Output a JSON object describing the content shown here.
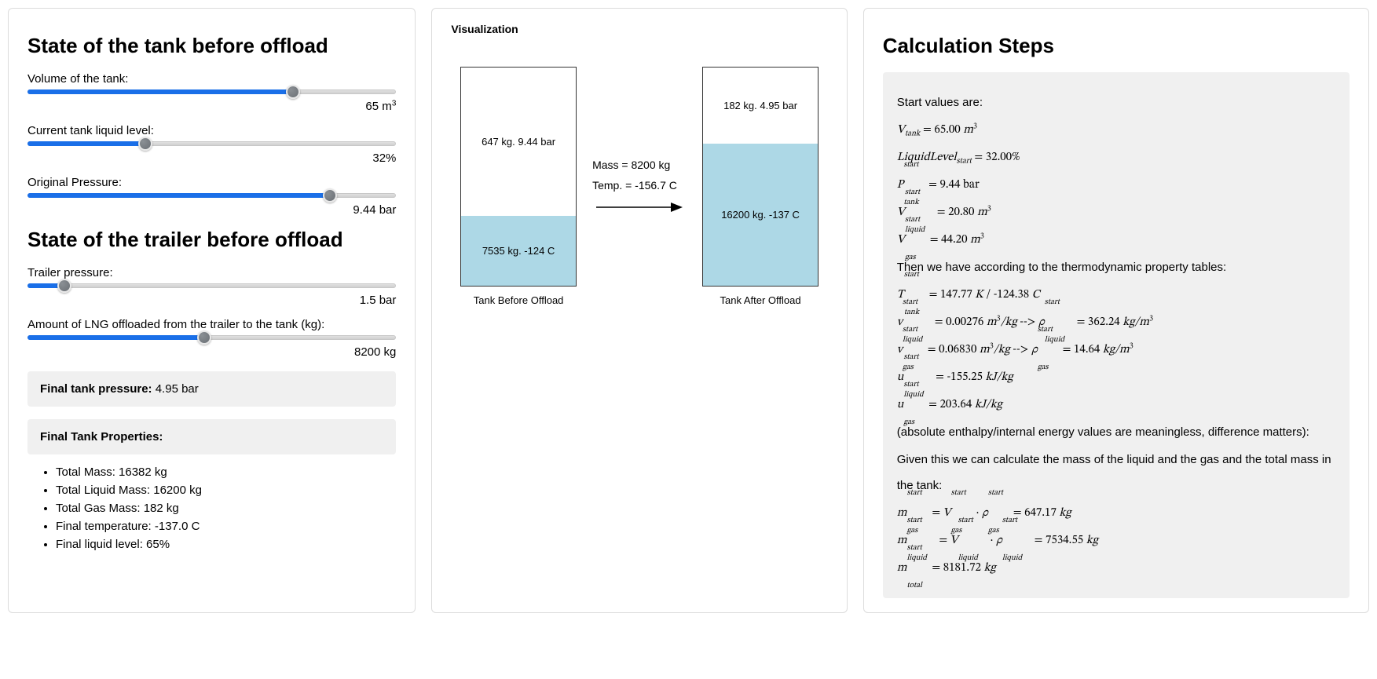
{
  "left": {
    "heading_before": "State of the tank before offload",
    "volume_label": "Volume of the tank:",
    "volume_value": "65 m",
    "volume_sup": "3",
    "volume_pct": 72,
    "level_label": "Current tank liquid level:",
    "level_value": "32%",
    "level_pct": 32,
    "pressure_label": "Original Pressure:",
    "pressure_value": "9.44 bar",
    "pressure_pct": 82,
    "heading_trailer": "State of the trailer before offload",
    "trailer_pressure_label": "Trailer pressure:",
    "trailer_pressure_value": "1.5 bar",
    "trailer_pressure_pct": 10,
    "offload_label": "Amount of LNG offloaded from the trailer to the tank (kg):",
    "offload_value": "8200 kg",
    "offload_pct": 48,
    "final_pressure_label": "Final tank pressure:",
    "final_pressure_value": "4.95 bar",
    "final_props_title": "Final Tank Properties:",
    "props": {
      "p0": "Total Mass: 16382 kg",
      "p1": "Total Liquid Mass: 16200 kg",
      "p2": "Total Gas Mass: 182 kg",
      "p3": "Final temperature: -137.0 C",
      "p4": "Final liquid level: 65%"
    }
  },
  "viz": {
    "title": "Visualization",
    "before": {
      "gas": "647 kg. 9.44 bar",
      "liquid": "7535 kg. -124 C",
      "label": "Tank Before Offload",
      "liquid_pct": 32
    },
    "after": {
      "gas": "182 kg. 4.95 bar",
      "liquid": "16200 kg. -137 C",
      "label": "Tank After Offload",
      "liquid_pct": 65
    },
    "mass_line": "Mass = 8200 kg",
    "temp_line": "Temp. = -156.7 C"
  },
  "calc": {
    "title": "Calculation Steps",
    "intro": "Start values are:",
    "v_tank": "65.00",
    "level": "32.00%",
    "p_start": "9.44 bar",
    "v_liq": "20.80",
    "v_gas": "44.20",
    "then": "Then we have according to the thermodynamic property tables:",
    "t_k": "147.77",
    "t_c": "-124.38",
    "sv_liq": "0.00276",
    "rho_liq": "362.24",
    "sv_gas": "0.06830",
    "rho_gas": "14.64",
    "u_liq": "-155.25",
    "u_gas": "203.64",
    "note": "(absolute enthalpy/internal energy values are meaningless, difference matters):",
    "given": "Given this we can calculate the mass of the liquid and the gas and the total mass in the tank:",
    "m_gas": "647.17",
    "m_liq": "7534.55",
    "m_tot": "8181.72"
  }
}
